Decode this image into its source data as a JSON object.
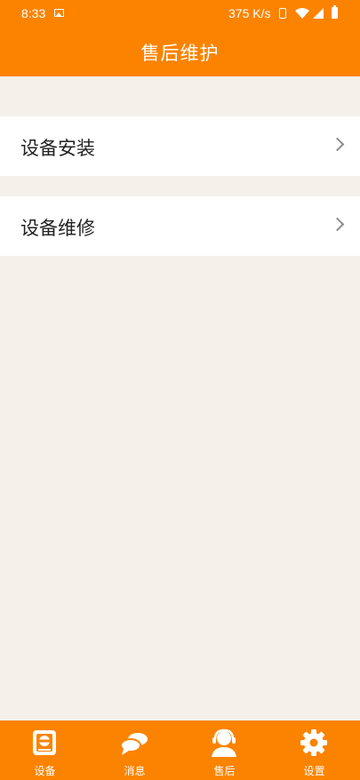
{
  "status_bar": {
    "time": "8:33",
    "net_speed": "375 K/s"
  },
  "header": {
    "title": "售后维护"
  },
  "menu": [
    {
      "label": "设备安装"
    },
    {
      "label": "设备维修"
    }
  ],
  "tabbar": {
    "tabs": [
      {
        "label": "设备",
        "icon": "device-icon"
      },
      {
        "label": "消息",
        "icon": "message-icon"
      },
      {
        "label": "售后",
        "icon": "support-icon"
      },
      {
        "label": "设置",
        "icon": "gear-icon"
      }
    ]
  },
  "colors": {
    "brand": "#fb8300",
    "background": "#f5f1ea",
    "row": "#ffffff",
    "text": "#222222",
    "chevron": "#8a8a8a"
  }
}
